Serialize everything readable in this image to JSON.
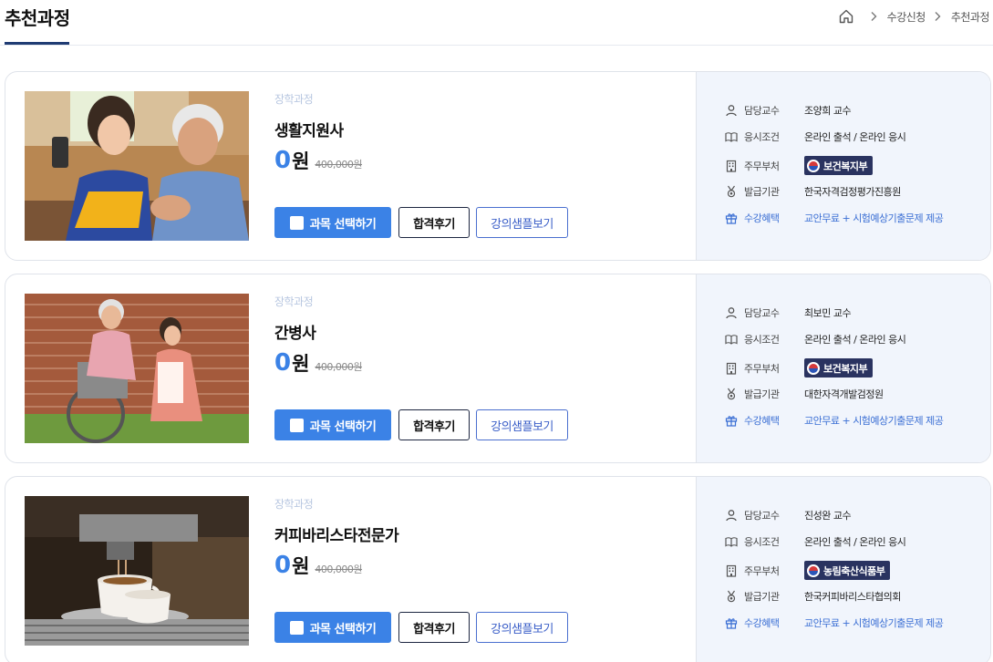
{
  "header": {
    "title": "추천과정",
    "breadcrumb": [
      "수강신청",
      "추천과정"
    ]
  },
  "labels": {
    "professor": "담당교수",
    "exam": "응시조건",
    "ministry": "주무부처",
    "issuer": "발급기관",
    "benefit": "수강혜택"
  },
  "buttons": {
    "select": "과목 선택하기",
    "review": "합격후기",
    "sample": "강의샘플보기"
  },
  "colors": {
    "accent": "#3b82e6",
    "navy": "#1f3b73",
    "badge": "#2a3360",
    "info_bg": "#f1f5fc"
  },
  "courses": [
    {
      "category": "장학과정",
      "name": "생활지원사",
      "price": "0",
      "price_unit": "원",
      "original_price": "400,000원",
      "professor": "조양희 교수",
      "exam": "온라인 출석 / 온라인 응시",
      "ministry": "보건복지부",
      "issuer": "한국자격검정평가진흥원",
      "benefit": "교안무료 + 시험예상기출문제 제공"
    },
    {
      "category": "장학과정",
      "name": "간병사",
      "price": "0",
      "price_unit": "원",
      "original_price": "400,000원",
      "professor": "최보민 교수",
      "exam": "온라인 출석 / 온라인 응시",
      "ministry": "보건복지부",
      "issuer": "대한자격개발검정원",
      "benefit": "교안무료 + 시험예상기출문제 제공"
    },
    {
      "category": "장학과정",
      "name": "커피바리스타전문가",
      "price": "0",
      "price_unit": "원",
      "original_price": "400,000원",
      "professor": "진성완 교수",
      "exam": "온라인 출석 / 온라인 응시",
      "ministry": "농림축산식품부",
      "issuer": "한국커피바리스타협의회",
      "benefit": "교안무료 + 시험예상기출문제 제공"
    }
  ]
}
